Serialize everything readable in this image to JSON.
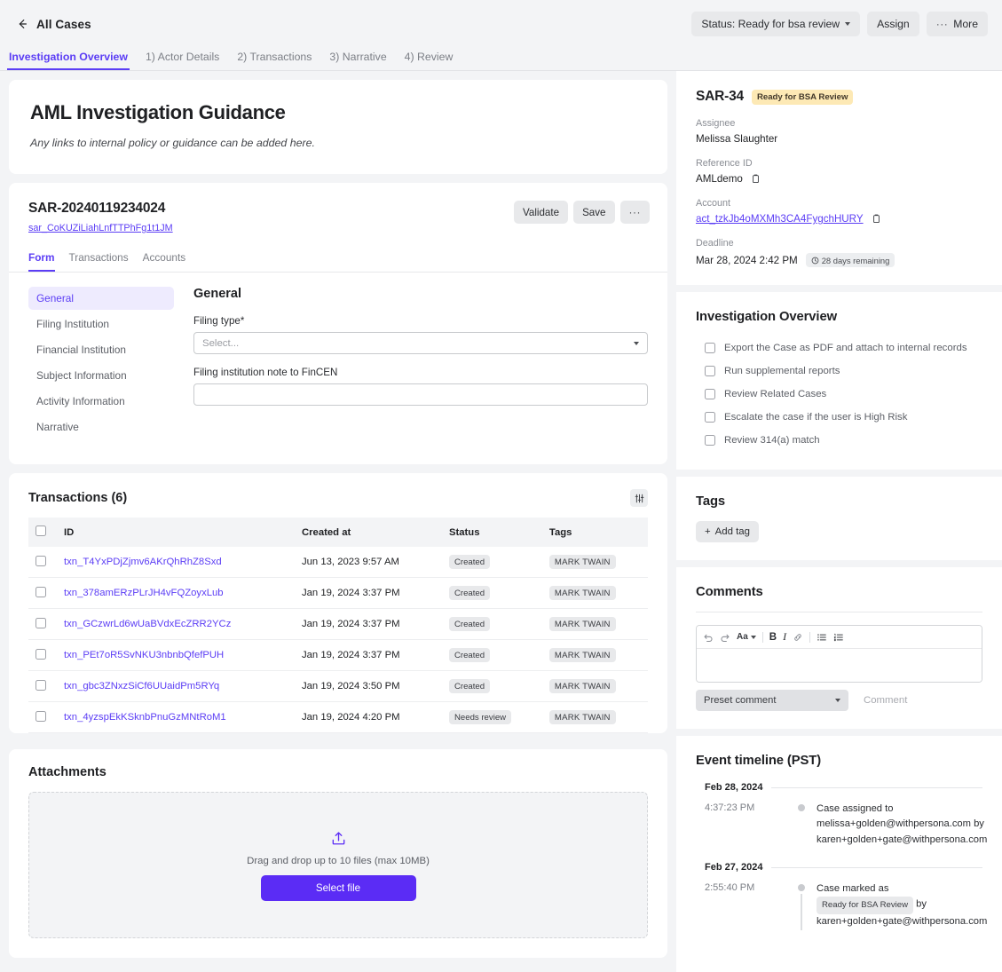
{
  "topbar": {
    "back_label": "All Cases",
    "status_label": "Status: Ready for bsa review",
    "assign_label": "Assign",
    "more_label": "More",
    "more_dots": "···"
  },
  "wizard_tabs": [
    {
      "label": "Investigation Overview",
      "active": true
    },
    {
      "label": "1) Actor Details",
      "active": false
    },
    {
      "label": "2) Transactions",
      "active": false
    },
    {
      "label": "3) Narrative",
      "active": false
    },
    {
      "label": "4) Review",
      "active": false
    }
  ],
  "guidance": {
    "title": "AML Investigation Guidance",
    "subtitle": "Any links to internal policy or guidance can be added here."
  },
  "sar_card": {
    "title": "SAR-20240119234024",
    "link": "sar_CoKUZiLiahLnfTTPhFg1t1JM",
    "validate_label": "Validate",
    "save_label": "Save",
    "more_dots": "···",
    "subtabs": [
      {
        "label": "Form",
        "active": true
      },
      {
        "label": "Transactions",
        "active": false
      },
      {
        "label": "Accounts",
        "active": false
      }
    ],
    "form_nav": [
      {
        "label": "General",
        "active": true
      },
      {
        "label": "Filing Institution",
        "active": false
      },
      {
        "label": "Financial Institution",
        "active": false
      },
      {
        "label": "Subject Information",
        "active": false
      },
      {
        "label": "Activity Information",
        "active": false
      },
      {
        "label": "Narrative",
        "active": false
      }
    ],
    "form": {
      "section_title": "General",
      "filing_type_label": "Filing type*",
      "filing_type_value": "Select...",
      "note_label": "Filing institution note to FinCEN",
      "note_value": "",
      "note_placeholder": ""
    }
  },
  "transactions": {
    "title": "Transactions (6)",
    "filter_icon": "sliders-icon",
    "columns": [
      "ID",
      "Created at",
      "Status",
      "Tags"
    ],
    "rows": [
      {
        "id": "txn_T4YxPDjZjmv6AKrQhRhZ8Sxd",
        "created_at": "Jun 13, 2023 9:57 AM",
        "status": "Created",
        "tag": "MARK TWAIN"
      },
      {
        "id": "txn_378amERzPLrJH4vFQZoyxLub",
        "created_at": "Jan 19, 2024 3:37 PM",
        "status": "Created",
        "tag": "MARK TWAIN"
      },
      {
        "id": "txn_GCzwrLd6wUaBVdxEcZRR2YCz",
        "created_at": "Jan 19, 2024 3:37 PM",
        "status": "Created",
        "tag": "MARK TWAIN"
      },
      {
        "id": "txn_PEt7oR5SvNKU3nbnbQfefPUH",
        "created_at": "Jan 19, 2024 3:37 PM",
        "status": "Created",
        "tag": "MARK TWAIN"
      },
      {
        "id": "txn_gbc3ZNxzSiCf6UUaidPm5RYq",
        "created_at": "Jan 19, 2024 3:50 PM",
        "status": "Created",
        "tag": "MARK TWAIN"
      },
      {
        "id": "txn_4yzspEkKSknbPnuGzMNtRoM1",
        "created_at": "Jan 19, 2024 4:20 PM",
        "status": "Needs review",
        "tag": "MARK TWAIN"
      }
    ]
  },
  "attachments": {
    "title": "Attachments",
    "upload_icon": "upload-icon",
    "drop_text": "Drag and drop up to 10 files (max 10MB)",
    "select_label": "Select file"
  },
  "case_panel": {
    "case_id": "SAR-34",
    "status_badge": "Ready for BSA Review",
    "fields": [
      {
        "label": "Assignee",
        "value": "Melissa Slaughter",
        "link": false,
        "copy": false
      },
      {
        "label": "Reference ID",
        "value": "AMLdemo",
        "link": false,
        "copy": true
      },
      {
        "label": "Account",
        "value": "act_tzkJb4oMXMh3CA4FygchHURY",
        "link": true,
        "copy": true
      }
    ],
    "deadline_label": "Deadline",
    "deadline_value": "Mar 28, 2024 2:42 PM",
    "deadline_pill": "28 days remaining"
  },
  "investigation_overview": {
    "title": "Investigation Overview",
    "items": [
      {
        "label": "Export the Case as PDF and attach to internal records",
        "checked": false
      },
      {
        "label": "Run supplemental reports",
        "checked": false
      },
      {
        "label": "Review Related Cases",
        "checked": false
      },
      {
        "label": "Escalate the case if the user is High Risk",
        "checked": false
      },
      {
        "label": "Review 314(a) match",
        "checked": false
      }
    ]
  },
  "tags": {
    "title": "Tags",
    "add_label": "Add tag",
    "add_plus": "+"
  },
  "comments": {
    "title": "Comments",
    "toolbar": [
      "undo-icon",
      "redo-icon",
      "text-style-icon",
      "bold-icon",
      "italic-icon",
      "link-icon",
      "bullet-list-icon",
      "numbered-list-icon"
    ],
    "text_style_label": "Aa",
    "bold_label": "B",
    "italic_label": "I",
    "editor_value": "",
    "preset_label": "Preset comment",
    "submit_label": "Comment"
  },
  "timeline": {
    "title": "Event timeline (PST)",
    "groups": [
      {
        "date": "Feb 28, 2024",
        "events": [
          {
            "time": "4:37:23 PM",
            "text_before": "Case assigned to melissa+golden@withpersona.com by karen+golden+gate@withpersona.com",
            "badge": "",
            "text_after": ""
          }
        ]
      },
      {
        "date": "Feb 27, 2024",
        "events": [
          {
            "time": "2:55:40 PM",
            "text_before": "Case marked as",
            "badge": "Ready for BSA Review",
            "text_after": "by karen+golden+gate@withpersona.com"
          }
        ]
      }
    ]
  },
  "colors": {
    "accent": "#5b3df5",
    "primary_button": "#5b2cf5",
    "page_bg": "#f3f4f6",
    "badge_amber": "#fde9b5"
  }
}
